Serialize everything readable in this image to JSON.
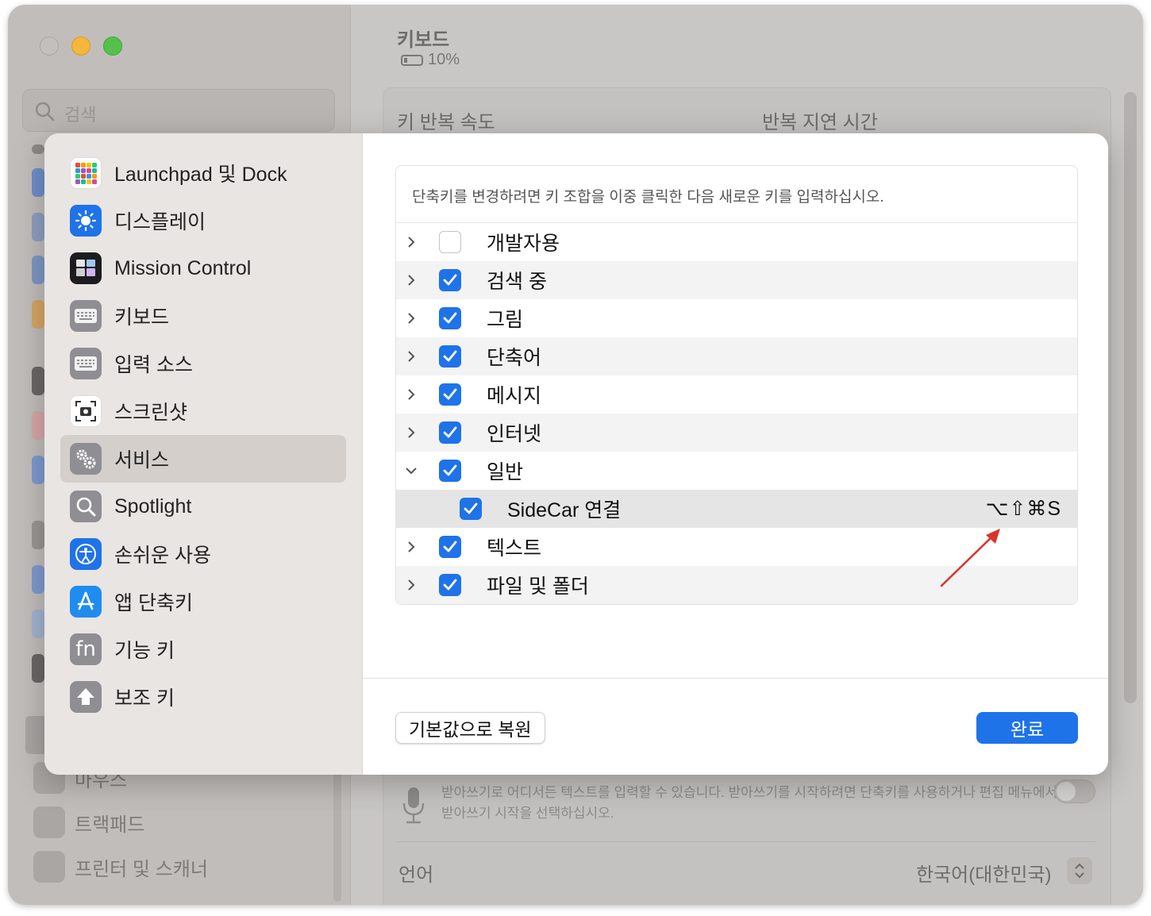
{
  "window": {
    "title": "키보드",
    "battery": "10%"
  },
  "background": {
    "search_placeholder": "검색",
    "key_repeat_label": "키 반복 속도",
    "repeat_delay_label": "반복 지연 시간",
    "dictation_text": "받아쓰기로 어디서든 텍스트를 입력할 수 있습니다. 받아쓰기를 시작하려면 단축키를 사용하거나 편집 메뉴에서 받아쓰기 시작을 선택하십시오.",
    "language_label": "언어",
    "language_value": "한국어(대한민국)",
    "sidebar_items": [
      {
        "label": "마우스"
      },
      {
        "label": "트랙패드"
      },
      {
        "label": "프린터 및 스캐너"
      }
    ]
  },
  "modal": {
    "sidebar": [
      {
        "label": "Launchpad 및 Dock",
        "icon": "launchpad-icon"
      },
      {
        "label": "디스플레이",
        "icon": "display-icon"
      },
      {
        "label": "Mission Control",
        "icon": "mission-control-icon"
      },
      {
        "label": "키보드",
        "icon": "keyboard-icon"
      },
      {
        "label": "입력 소스",
        "icon": "input-source-icon"
      },
      {
        "label": "스크린샷",
        "icon": "screenshot-icon"
      },
      {
        "label": "서비스",
        "icon": "services-icon",
        "selected": true
      },
      {
        "label": "Spotlight",
        "icon": "spotlight-icon"
      },
      {
        "label": "손쉬운 사용",
        "icon": "accessibility-icon"
      },
      {
        "label": "앱 단축키",
        "icon": "app-shortcuts-icon"
      },
      {
        "label": "기능 키",
        "icon": "fn-key-icon"
      },
      {
        "label": "보조 키",
        "icon": "modifier-keys-icon"
      }
    ],
    "instruction": "단축키를 변경하려면 키 조합을 이중 클릭한 다음 새로운 키를 입력하십시오.",
    "rows": [
      {
        "label": "개발자용",
        "checked": false,
        "expanded": false
      },
      {
        "label": "검색 중",
        "checked": true,
        "expanded": false
      },
      {
        "label": "그림",
        "checked": true,
        "expanded": false
      },
      {
        "label": "단축어",
        "checked": true,
        "expanded": false
      },
      {
        "label": "메시지",
        "checked": true,
        "expanded": false
      },
      {
        "label": "인터넷",
        "checked": true,
        "expanded": false
      },
      {
        "label": "일반",
        "checked": true,
        "expanded": true
      },
      {
        "label": "SideCar 연결",
        "checked": true,
        "child": true,
        "shortcut": "⌥⇧⌘S"
      },
      {
        "label": "텍스트",
        "checked": true,
        "expanded": false
      },
      {
        "label": "파일 및 폴더",
        "checked": true,
        "expanded": false
      }
    ],
    "restore_button": "기본값으로 복원",
    "done_button": "완료"
  },
  "colors": {
    "accent": "#1f73e8",
    "annotation_arrow": "#d9342b"
  }
}
